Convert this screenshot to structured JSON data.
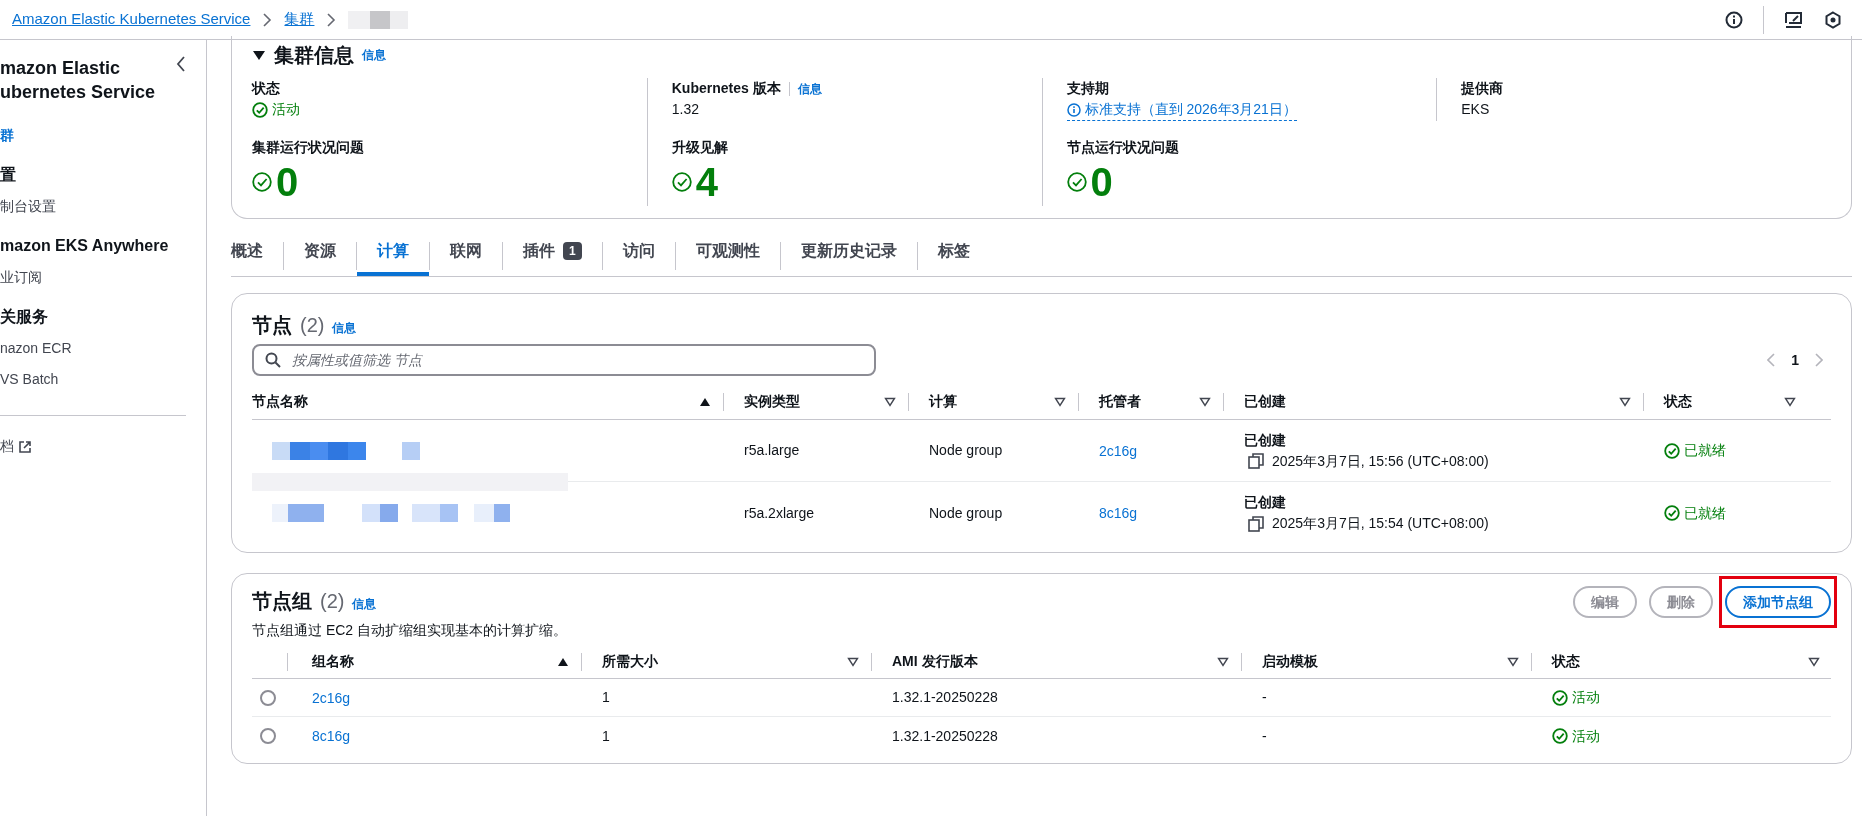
{
  "breadcrumb": [
    {
      "label": "Amazon Elastic Kubernetes Service"
    },
    {
      "label": "集群"
    }
  ],
  "sidebar": {
    "title_lines": [
      "mazon Elastic",
      "ubernetes Service"
    ],
    "items": [
      {
        "kind": "link",
        "label": "群",
        "selected": true
      },
      {
        "kind": "heading",
        "label": "置"
      },
      {
        "kind": "item",
        "label": "制台设置",
        "selected": false
      },
      {
        "kind": "heading",
        "label": "mazon EKS Anywhere"
      },
      {
        "kind": "item",
        "label": "业订阅",
        "selected": false
      },
      {
        "kind": "heading",
        "label": "关服务"
      },
      {
        "kind": "item",
        "label": "nazon ECR",
        "selected": false
      },
      {
        "kind": "item",
        "label": "VS Batch",
        "selected": false
      },
      {
        "kind": "divider"
      },
      {
        "kind": "external",
        "label": "档",
        "selected": false
      }
    ]
  },
  "cluster_info": {
    "title": "集群信息",
    "info": "信息",
    "expanded": true,
    "fields": [
      {
        "kind": "status",
        "label": "状态",
        "value": "活动"
      },
      {
        "kind": "text",
        "label": "Kubernetes 版本",
        "info": "信息",
        "value": "1.32"
      },
      {
        "kind": "support",
        "label": "支持期",
        "value": "标准支持（直到 2026年3月21日）"
      },
      {
        "kind": "text",
        "label": "提供商",
        "value": "EKS"
      }
    ],
    "metrics": [
      {
        "label": "集群运行状况问题",
        "value": "0"
      },
      {
        "label": "升级见解",
        "value": "4"
      },
      {
        "label": "节点运行状况问题",
        "value": "0"
      }
    ]
  },
  "tabs": [
    {
      "label": "概述",
      "selected": false
    },
    {
      "label": "资源",
      "selected": false
    },
    {
      "label": "计算",
      "selected": true
    },
    {
      "label": "联网",
      "selected": false
    },
    {
      "label": "插件",
      "badge": "1",
      "selected": false
    },
    {
      "label": "访问",
      "selected": false
    },
    {
      "label": "可观测性",
      "selected": false
    },
    {
      "label": "更新历史记录",
      "selected": false
    },
    {
      "label": "标签",
      "selected": false
    }
  ],
  "nodes": {
    "title": "节点",
    "count": "(2)",
    "info": "信息",
    "search": {
      "placeholder": "按属性或值筛选 节点"
    },
    "page": "1",
    "columns": [
      {
        "label": "节点名称",
        "sorted": true
      },
      {
        "label": "实例类型",
        "sorted": false
      },
      {
        "label": "计算",
        "sorted": false
      },
      {
        "label": "托管者",
        "sorted": false
      },
      {
        "label": "已创建",
        "sorted": false
      },
      {
        "label": "状态",
        "sorted": false
      }
    ],
    "rows": [
      {
        "instance_type": "r5a.large",
        "compute": "Node group",
        "managed_by": "2c16g",
        "created_label": "已创建",
        "created": "2025年3月7日, 15:56 (UTC+08:00)",
        "status": "已就绪"
      },
      {
        "instance_type": "r5a.2xlarge",
        "compute": "Node group",
        "managed_by": "8c16g",
        "created_label": "已创建",
        "created": "2025年3月7日, 15:54 (UTC+08:00)",
        "status": "已就绪"
      }
    ]
  },
  "node_groups": {
    "title": "节点组",
    "count": "(2)",
    "info": "信息",
    "description": "节点组通过 EC2 自动扩缩组实现基本的计算扩缩。",
    "buttons": [
      {
        "label": "编辑",
        "disabled": true
      },
      {
        "label": "删除",
        "disabled": true
      },
      {
        "label": "添加节点组",
        "disabled": false,
        "highlighted": true
      }
    ],
    "columns": [
      {
        "label": "组名称",
        "sorted": true
      },
      {
        "label": "所需大小",
        "sorted": false
      },
      {
        "label": "AMI 发行版本",
        "sorted": false
      },
      {
        "label": "启动模板",
        "sorted": false
      },
      {
        "label": "状态",
        "sorted": false
      }
    ],
    "rows": [
      {
        "name": "2c16g",
        "desired_size": "1",
        "ami": "1.32.1-20250228",
        "template": "-",
        "status": "活动",
        "selected": false
      },
      {
        "name": "8c16g",
        "desired_size": "1",
        "ami": "1.32.1-20250228",
        "template": "-",
        "status": "活动",
        "selected": false
      }
    ]
  }
}
